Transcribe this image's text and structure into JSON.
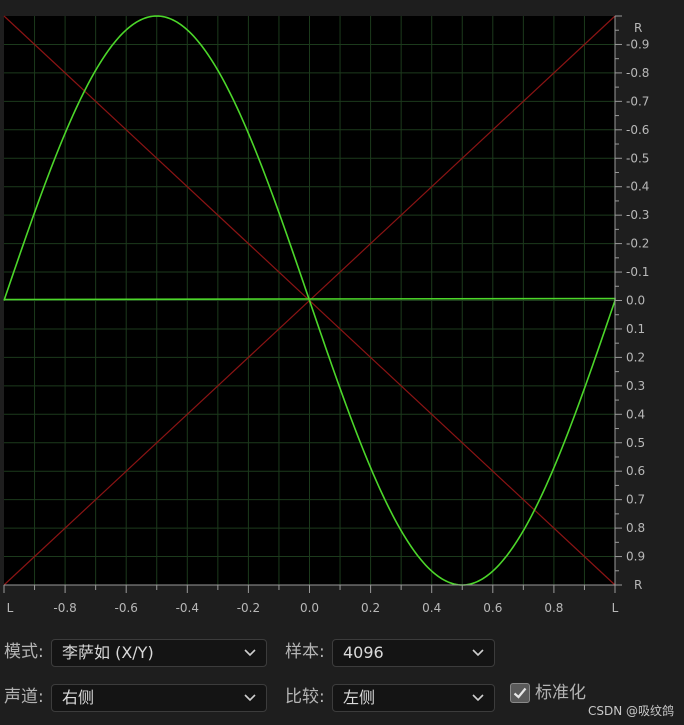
{
  "plot": {
    "x_ticks": [
      "L",
      "-0.8",
      "-0.6",
      "-0.4",
      "-0.2",
      "0.0",
      "0.2",
      "0.4",
      "0.6",
      "0.8",
      "L"
    ],
    "y_ticks": [
      "R",
      "-0.9",
      "-0.8",
      "-0.7",
      "-0.6",
      "-0.5",
      "-0.4",
      "-0.3",
      "-0.2",
      "-0.1",
      "0.0",
      "0.1",
      "0.2",
      "0.3",
      "0.4",
      "0.5",
      "0.6",
      "0.7",
      "0.8",
      "0.9",
      "R"
    ],
    "colors": {
      "background": "#000000",
      "grid": "#1c3a1c",
      "diagonal": "#8b1414",
      "trace": "#4cd62a"
    }
  },
  "controls": {
    "mode_label": "模式:",
    "mode_value": "李萨如 (X/Y)",
    "samples_label": "样本:",
    "samples_value": "4096",
    "channel_label": "声道:",
    "channel_value": "右侧",
    "compare_label": "比较:",
    "compare_value": "左侧",
    "normalize_label": "标准化",
    "normalize_checked": true
  },
  "watermark": "CSDN @吸纹鸽"
}
